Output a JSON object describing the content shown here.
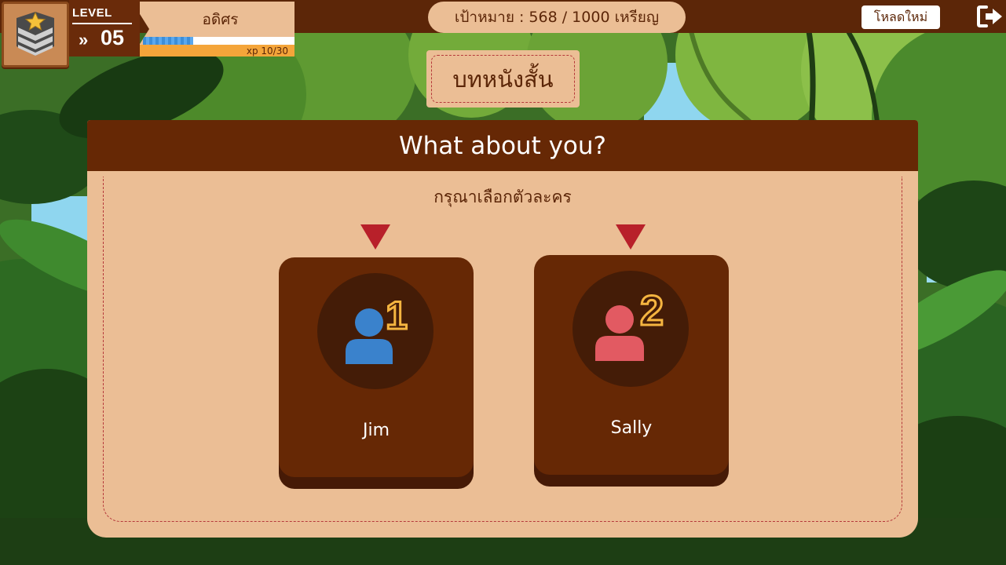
{
  "player": {
    "level_label": "LEVEL",
    "level_chevron": "»",
    "level_number": "05",
    "name": "อดิศร",
    "xp_text": "xp 10/30",
    "xp_fraction": 0.333
  },
  "header": {
    "goal_text": "เป้าหมาย : 568 / 1000 เหรียญ",
    "reload_label": "โหลดใหม่",
    "exit_icon": "sign-out-icon"
  },
  "sign": {
    "title": "บทหนังสั้น"
  },
  "panel": {
    "title": "What about you?",
    "instruction": "กรุณาเลือกตัวละคร"
  },
  "characters": [
    {
      "name": "Jim",
      "number": "1",
      "color": "#3a82cc",
      "icon": "user-icon"
    },
    {
      "name": "Sally",
      "number": "2",
      "color": "#e25a62",
      "icon": "user-icon"
    }
  ],
  "colors": {
    "brown_dark": "#5c2608",
    "panel_tan": "#ebbe95",
    "card_brown": "#662805",
    "accent_red": "#b8202a",
    "number_gold": "#f5b540"
  }
}
